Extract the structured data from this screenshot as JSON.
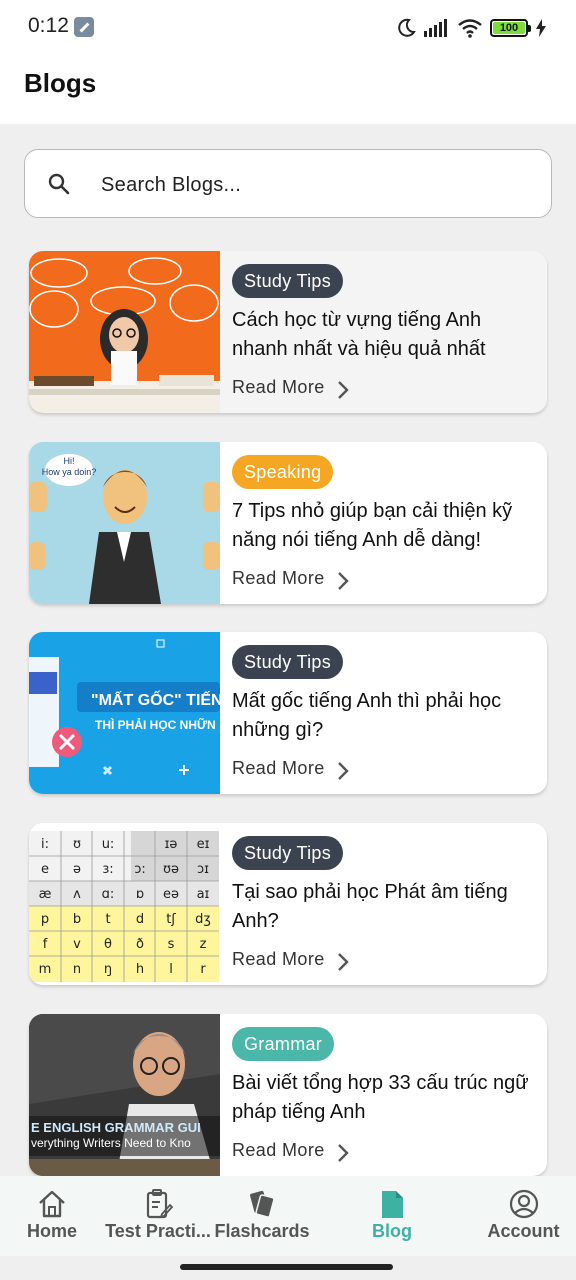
{
  "status_bar": {
    "time": "0:12",
    "battery": "100"
  },
  "header": {
    "title": "Blogs"
  },
  "search": {
    "placeholder": "Search Blogs..."
  },
  "colors": {
    "accent": "#3db2a2",
    "tag_study": "#3c4350",
    "tag_speaking": "#f5a623",
    "tag_grammar": "#4bb7a8"
  },
  "blogs": [
    {
      "tag": "Study Tips",
      "title": "Cách học từ vựng tiếng Anh nhanh nhất và hiệu quả nhất",
      "read_more": "Read More"
    },
    {
      "tag": "Speaking",
      "title": "7 Tips nhỏ giúp bạn cải thiện kỹ năng nói tiếng Anh dễ dàng!",
      "read_more": "Read More"
    },
    {
      "tag": "Study Tips",
      "title": "Mất gốc tiếng Anh thì phải học những gì?",
      "read_more": "Read More"
    },
    {
      "tag": "Study Tips",
      "title": "Tại sao phải học Phát âm tiếng Anh?",
      "read_more": "Read More"
    },
    {
      "tag": "Grammar",
      "title": "Bài viết tổng hợp 33 cấu trúc ngữ pháp tiếng Anh",
      "read_more": "Read More"
    }
  ],
  "thumb_text": {
    "speech": "Hi!\nHow ya doin?",
    "mat_goc": "\"MẤT GỐC\" TIẾNG",
    "thi_phai": "THÌ PHẢI HỌC NHỮN",
    "grammar_banner": "E ENGLISH GRAMMAR GUI",
    "grammar_sub": "verything Writers Need to Kno"
  },
  "nav": {
    "items": [
      {
        "label": "Home",
        "icon": "home-icon"
      },
      {
        "label": "Test Practi...",
        "icon": "clipboard-edit-icon"
      },
      {
        "label": "Flashcards",
        "icon": "cards-icon"
      },
      {
        "label": "Blog",
        "icon": "document-icon"
      },
      {
        "label": "Account",
        "icon": "account-circle-icon"
      }
    ],
    "active": "Blog"
  }
}
